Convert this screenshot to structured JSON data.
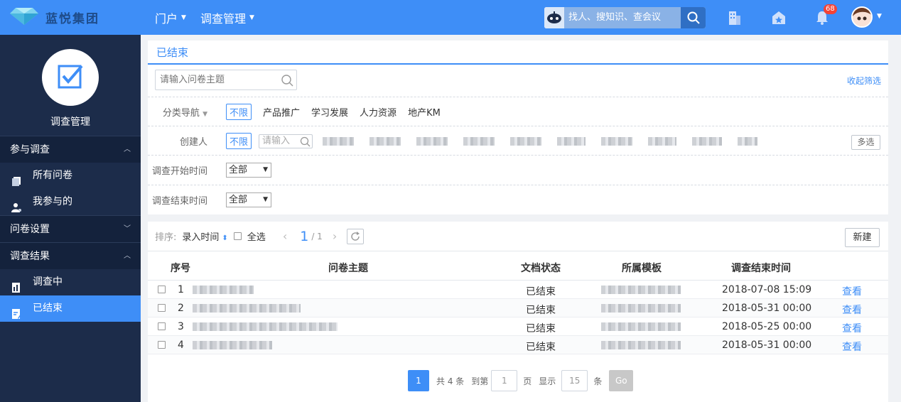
{
  "header": {
    "brand": "蓝悦集团",
    "nav": [
      {
        "label": "门户"
      },
      {
        "label": "调查管理"
      }
    ],
    "search_placeholder": "找人、搜知识、查会议",
    "notification_count": "68",
    "icons": [
      "building-icon",
      "home-star-icon",
      "bell-icon"
    ]
  },
  "sidebar": {
    "title": "调查管理",
    "groups": [
      {
        "label": "参与调查",
        "expanded": true,
        "items": [
          {
            "label": "所有问卷"
          },
          {
            "label": "我参与的"
          }
        ]
      },
      {
        "label": "问卷设置",
        "expanded": false,
        "items": []
      },
      {
        "label": "调查结果",
        "expanded": true,
        "items": [
          {
            "label": "调查中"
          },
          {
            "label": "已结束",
            "active": true
          }
        ]
      }
    ]
  },
  "main": {
    "title": "已结束",
    "search_placeholder": "请输入问卷主题",
    "collapse_filter": "收起筛选",
    "filters": {
      "category": {
        "label": "分类导航",
        "active": "不限",
        "options": [
          "产品推广",
          "学习发展",
          "人力资源",
          "地产KM"
        ]
      },
      "creator": {
        "label": "创建人",
        "active": "不限",
        "input_placeholder": "请输入",
        "multi_select": "多选"
      },
      "start_time": {
        "label": "调查开始时间",
        "value": "全部"
      },
      "end_time": {
        "label": "调查结束时间",
        "value": "全部"
      }
    },
    "toolbar": {
      "sort_label": "排序:",
      "sort_field": "录入时间",
      "select_all": "全选",
      "current_page": "1",
      "total_pages": "/ 1",
      "new_button": "新建"
    },
    "table": {
      "columns": [
        "序号",
        "问卷主题",
        "文档状态",
        "所属模板",
        "调查结束时间",
        ""
      ],
      "rows": [
        {
          "index": "1",
          "status": "已结束",
          "end_time": "2018-07-08 15:09",
          "action": "查看"
        },
        {
          "index": "2",
          "status": "已结束",
          "end_time": "2018-05-31 00:00",
          "action": "查看"
        },
        {
          "index": "3",
          "status": "已结束",
          "end_time": "2018-05-25 00:00",
          "action": "查看"
        },
        {
          "index": "4",
          "status": "已结束",
          "end_time": "2018-05-31 00:00",
          "action": "查看"
        }
      ]
    },
    "pagination": {
      "current": "1",
      "total_text": "共 4 条",
      "goto_label": "到第",
      "goto_value": "1",
      "page_unit": "页",
      "show_label": "显示",
      "page_size": "15",
      "size_unit": "条",
      "go_label": "Go"
    }
  },
  "colors": {
    "primary": "#3e8ef7",
    "sidebar": "#1c2c4a",
    "badge": "#f44336"
  }
}
